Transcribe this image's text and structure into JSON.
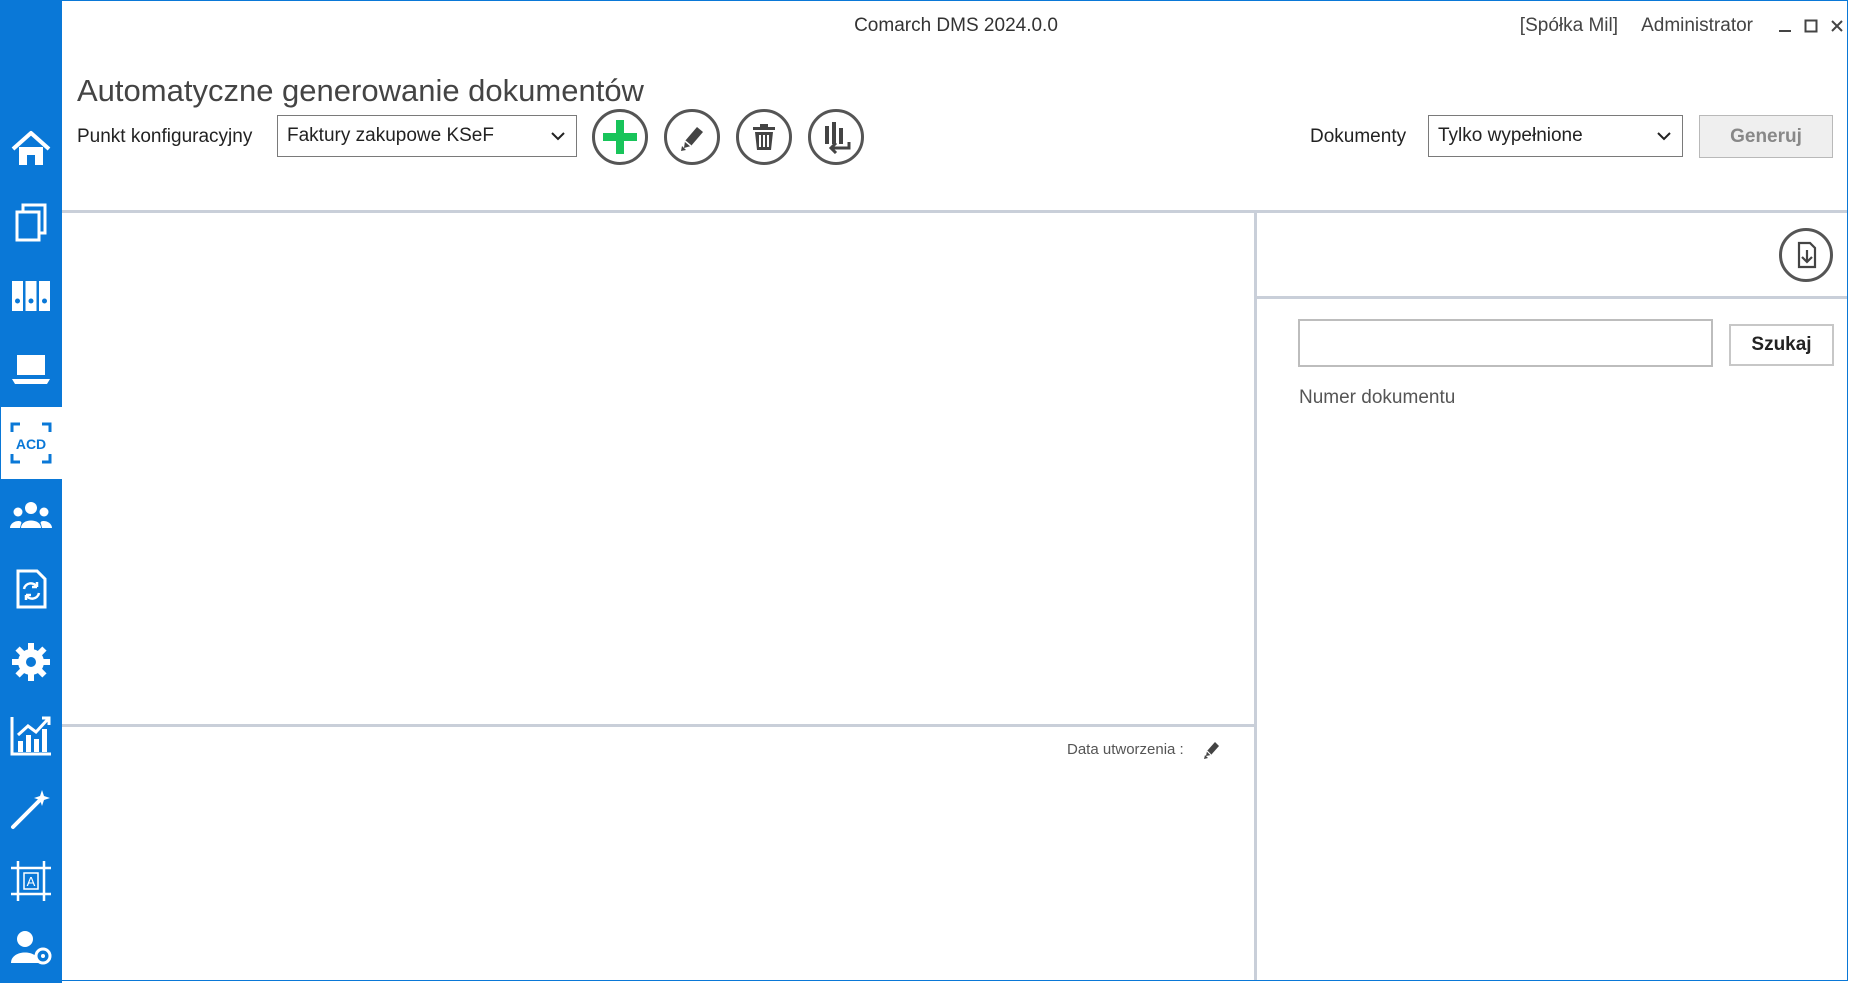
{
  "window": {
    "app_title": "Comarch DMS 2024.0.0",
    "company": "[Spółka Mil]",
    "user": "Administrator"
  },
  "page": {
    "title": "Automatyczne generowanie dokumentów"
  },
  "toolbar": {
    "config_label": "Punkt konfiguracyjny",
    "config_value": "Faktury zakupowe KSeF",
    "documents_label": "Dokumenty",
    "documents_value": "Tylko wypełnione",
    "generate_label": "Generuj"
  },
  "right_panel": {
    "search_value": "",
    "search_button": "Szukaj",
    "doc_number_label": "Numer dokumentu"
  },
  "bottom_panel": {
    "date_label": "Data utworzenia :"
  },
  "colors": {
    "sidebar": "#0a78d7",
    "add_green": "#18c45a",
    "divider": "#c9cfd9"
  },
  "sidebar": {
    "items": [
      {
        "icon": "home-icon"
      },
      {
        "icon": "documents-icon"
      },
      {
        "icon": "binders-icon"
      },
      {
        "icon": "laptop-icon"
      },
      {
        "icon": "acd-icon",
        "text": "ACD"
      },
      {
        "icon": "users-icon"
      },
      {
        "icon": "document-sync-icon"
      },
      {
        "icon": "gear-icon"
      },
      {
        "icon": "chart-icon"
      },
      {
        "icon": "magic-wand-icon"
      },
      {
        "icon": "text-frame-icon",
        "text": "A"
      },
      {
        "icon": "user-settings-icon"
      }
    ]
  }
}
